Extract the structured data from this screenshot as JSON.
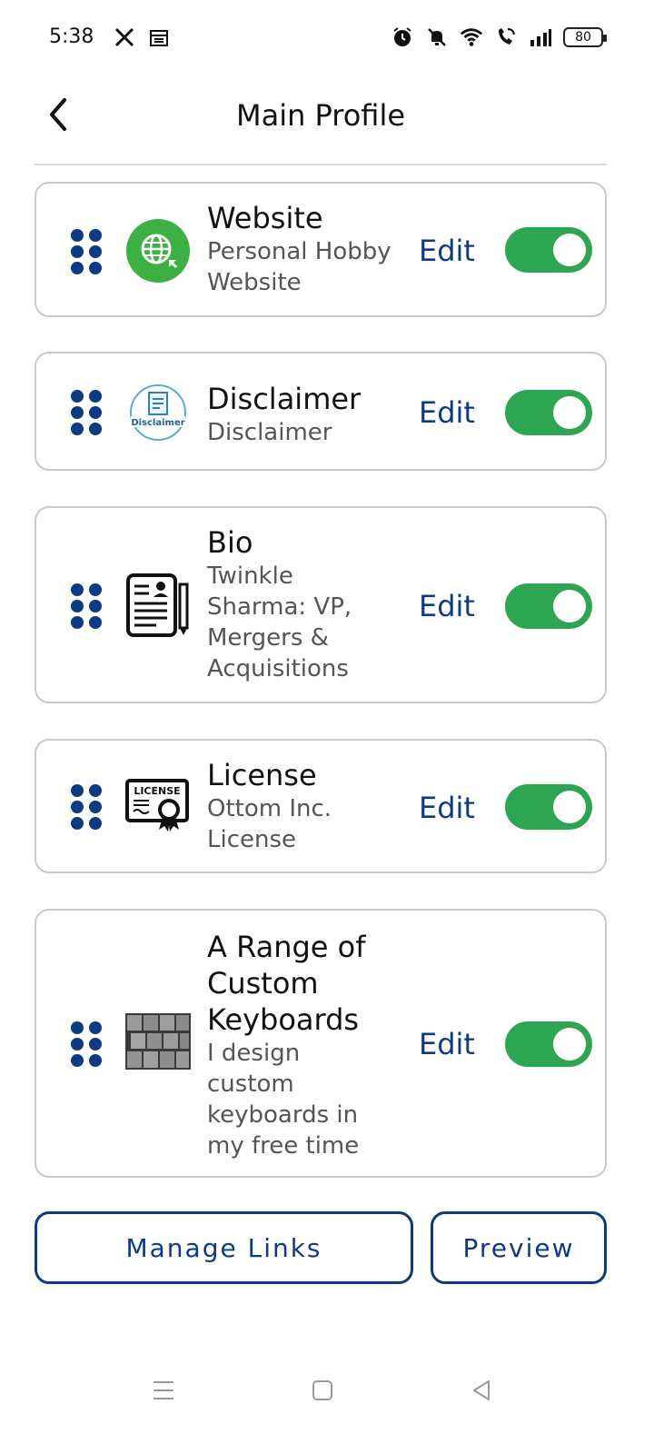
{
  "status_bar": {
    "time": "5:38",
    "left_icons": [
      "x-icon",
      "calendar-icon"
    ],
    "right_icons": [
      "alarm-icon",
      "mute-icon",
      "wifi-icon",
      "wifi-call-icon",
      "signal-icon"
    ],
    "battery_level": "80"
  },
  "header": {
    "title": "Main Profile",
    "back_icon": "chevron-left-icon"
  },
  "items": [
    {
      "title": "Website",
      "subtitle": "Personal Hobby Website",
      "icon": "globe-icon",
      "edit_label": "Edit",
      "enabled": true
    },
    {
      "title": "Disclaimer",
      "subtitle": "Disclaimer",
      "icon": "disclaimer-icon",
      "edit_label": "Edit",
      "enabled": true
    },
    {
      "title": "Bio",
      "subtitle": "Twinkle Sharma: VP, Mergers & Acquisitions",
      "icon": "bio-document-icon",
      "edit_label": "Edit",
      "enabled": true
    },
    {
      "title": "License",
      "subtitle": "Ottom Inc. License",
      "icon": "license-icon",
      "edit_label": "Edit",
      "enabled": true,
      "logo_text": "LICENSE"
    },
    {
      "title": "A Range of Custom Keyboards",
      "subtitle": "I design custom keyboards in my free time",
      "icon": "keyboard-photo",
      "edit_label": "Edit",
      "enabled": true
    }
  ],
  "buttons": {
    "manage_links": "Manage Links",
    "preview": "Preview"
  },
  "nav_bar": {
    "icons": [
      "menu-icon",
      "home-icon",
      "back-icon"
    ]
  },
  "colors": {
    "accent": "#0d3b82",
    "toggle_on": "#2ea553",
    "border": "#c9c9c9"
  }
}
